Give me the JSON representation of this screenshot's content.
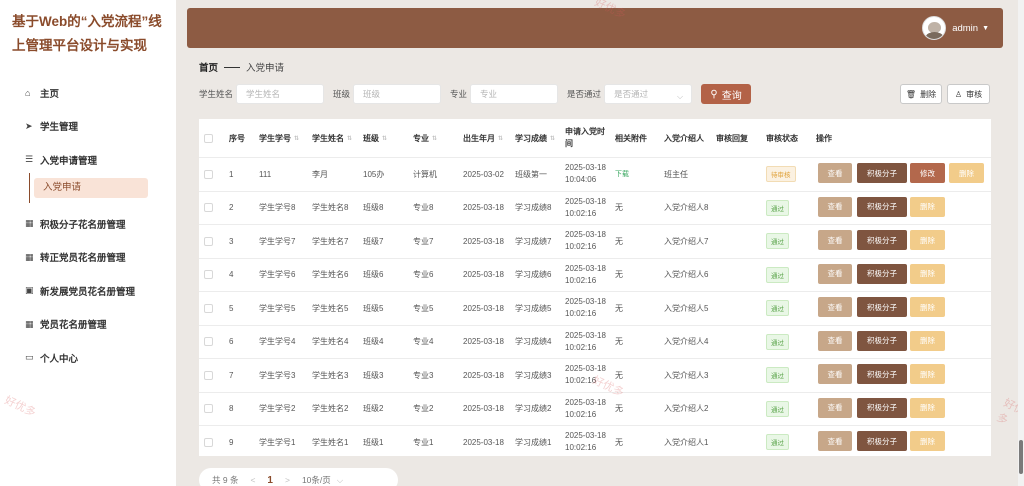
{
  "app_title": "基于Web的“入党流程”线上管理平台设计与实现",
  "sidebar": {
    "items": [
      {
        "icon": "home-icon",
        "glyph": "⌂",
        "label": "主页"
      },
      {
        "icon": "send-icon",
        "glyph": "➤",
        "label": "学生管理"
      },
      {
        "icon": "list-icon",
        "glyph": "☰",
        "label": "入党申请管理"
      },
      {
        "icon": "grid-icon",
        "glyph": "▦",
        "label": "积极分子花名册管理"
      },
      {
        "icon": "grid-icon",
        "glyph": "▦",
        "label": "转正党员花名册管理"
      },
      {
        "icon": "checkbox-icon",
        "glyph": "▣",
        "label": "新发展党员花名册管理"
      },
      {
        "icon": "grid-icon",
        "glyph": "▦",
        "label": "党员花名册管理"
      },
      {
        "icon": "monitor-icon",
        "glyph": "▭",
        "label": "个人中心"
      }
    ],
    "sub_item": "入党申请"
  },
  "header": {
    "username": "admin",
    "caret": "▼"
  },
  "breadcrumb": {
    "home": "首页",
    "current": "入党申请"
  },
  "search": {
    "name_label": "学生姓名",
    "name_placeholder": "学生姓名",
    "class_label": "班级",
    "class_placeholder": "班级",
    "major_label": "专业",
    "major_placeholder": "专业",
    "pass_label": "是否通过",
    "pass_placeholder": "是否通过",
    "query_label": "查询",
    "select_caret": "⌵"
  },
  "toolbar": {
    "delete_label": "删除",
    "review_label": "审核"
  },
  "table": {
    "columns": [
      "序号",
      "学生学号",
      "学生姓名",
      "班级",
      "专业",
      "出生年月",
      "学习成绩",
      "申请入党时间",
      "相关附件",
      "入党介绍人",
      "审核回复",
      "审核状态",
      "操作"
    ],
    "rows": [
      {
        "idx": "1",
        "sid": "111",
        "name": "李月",
        "cls": "105办",
        "major": "计算机",
        "birth": "2025-03-02",
        "score": "班级第一",
        "apply_date": "2025-03-18",
        "apply_time": "10:04:06",
        "attach": "下载",
        "intro": "班主任",
        "status": "待审核"
      },
      {
        "idx": "2",
        "sid": "学生学号8",
        "name": "学生姓名8",
        "cls": "班级8",
        "major": "专业8",
        "birth": "2025-03-18",
        "score": "学习成绩8",
        "apply_date": "2025-03-18",
        "apply_time": "10:02:16",
        "attach": "无",
        "intro": "入党介绍人8",
        "status": "通过"
      },
      {
        "idx": "3",
        "sid": "学生学号7",
        "name": "学生姓名7",
        "cls": "班级7",
        "major": "专业7",
        "birth": "2025-03-18",
        "score": "学习成绩7",
        "apply_date": "2025-03-18",
        "apply_time": "10:02:16",
        "attach": "无",
        "intro": "入党介绍人7",
        "status": "通过"
      },
      {
        "idx": "4",
        "sid": "学生学号6",
        "name": "学生姓名6",
        "cls": "班级6",
        "major": "专业6",
        "birth": "2025-03-18",
        "score": "学习成绩6",
        "apply_date": "2025-03-18",
        "apply_time": "10:02:16",
        "attach": "无",
        "intro": "入党介绍人6",
        "status": "通过"
      },
      {
        "idx": "5",
        "sid": "学生学号5",
        "name": "学生姓名5",
        "cls": "班级5",
        "major": "专业5",
        "birth": "2025-03-18",
        "score": "学习成绩5",
        "apply_date": "2025-03-18",
        "apply_time": "10:02:16",
        "attach": "无",
        "intro": "入党介绍人5",
        "status": "通过"
      },
      {
        "idx": "6",
        "sid": "学生学号4",
        "name": "学生姓名4",
        "cls": "班级4",
        "major": "专业4",
        "birth": "2025-03-18",
        "score": "学习成绩4",
        "apply_date": "2025-03-18",
        "apply_time": "10:02:16",
        "attach": "无",
        "intro": "入党介绍人4",
        "status": "通过"
      },
      {
        "idx": "7",
        "sid": "学生学号3",
        "name": "学生姓名3",
        "cls": "班级3",
        "major": "专业3",
        "birth": "2025-03-18",
        "score": "学习成绩3",
        "apply_date": "2025-03-18",
        "apply_time": "10:02:16",
        "attach": "无",
        "intro": "入党介绍人3",
        "status": "通过"
      },
      {
        "idx": "8",
        "sid": "学生学号2",
        "name": "学生姓名2",
        "cls": "班级2",
        "major": "专业2",
        "birth": "2025-03-18",
        "score": "学习成绩2",
        "apply_date": "2025-03-18",
        "apply_time": "10:02:16",
        "attach": "无",
        "intro": "入党介绍人2",
        "status": "通过"
      },
      {
        "idx": "9",
        "sid": "学生学号1",
        "name": "学生姓名1",
        "cls": "班级1",
        "major": "专业1",
        "birth": "2025-03-18",
        "score": "学习成绩1",
        "apply_date": "2025-03-18",
        "apply_time": "10:02:16",
        "attach": "无",
        "intro": "入党介绍人1",
        "status": "通过"
      }
    ],
    "actions": {
      "view": "查看",
      "activist": "积极分子",
      "edit": "修改",
      "delete": "删除"
    }
  },
  "pager": {
    "total": "共 9 条",
    "prev": "<",
    "current": "1",
    "next": ">",
    "page_size": "10条/页",
    "size_caret": "⌵"
  },
  "watermark": "好优多",
  "colors": {
    "header_bg": "#8d5b43",
    "accent": "#b36247",
    "brand_text": "#8a4b2b",
    "view_btn": "#c7a789",
    "activist_btn": "#7f5540",
    "edit_btn": "#b3684c",
    "delete_btn": "#f2cc8a",
    "pass_tag": "#5aa44a",
    "pending_tag": "#e0a23b"
  }
}
